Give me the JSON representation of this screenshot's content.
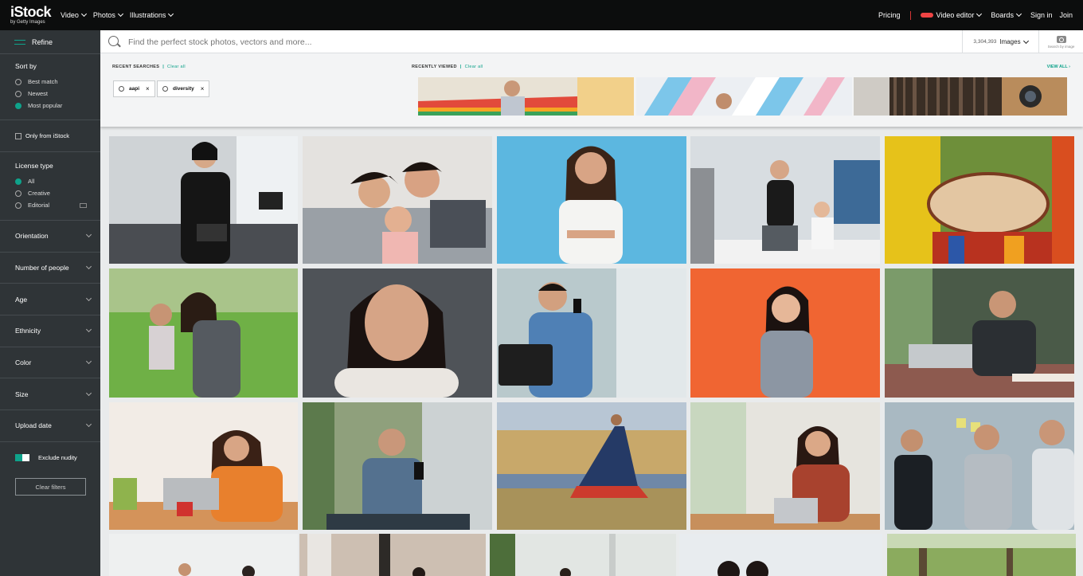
{
  "header": {
    "logo_text": "iStock",
    "logo_tagline": "by Getty Images",
    "nav": [
      {
        "label": "Video"
      },
      {
        "label": "Photos"
      },
      {
        "label": "Illustrations"
      }
    ],
    "right_nav": {
      "pricing": "Pricing",
      "video_editor": "Video editor",
      "boards": "Boards",
      "sign_in": "Sign in",
      "join": "Join"
    }
  },
  "sidebar": {
    "refine_label": "Refine",
    "sort_by": {
      "title": "Sort by",
      "options": [
        "Best match",
        "Newest",
        "Most popular"
      ],
      "selected": "Most popular"
    },
    "only_from_istock": "Only from iStock",
    "license_type": {
      "title": "License type",
      "options": [
        "All",
        "Creative",
        "Editorial"
      ],
      "selected": "All"
    },
    "filters": [
      "Orientation",
      "Number of people",
      "Age",
      "Ethnicity",
      "Color",
      "Size",
      "Upload date"
    ],
    "exclude_nudity": "Exclude nudity",
    "clear_filters": "Clear filters"
  },
  "search": {
    "placeholder": "Find the perfect stock photos, vectors and more...",
    "result_count": "3,304,393",
    "media_type": "Images",
    "search_by_image": "Search by image"
  },
  "recent": {
    "searches_title": "RECENT SEARCHES",
    "clear_all": "Clear all",
    "chips": [
      {
        "label": "aapi"
      },
      {
        "label": "diversity"
      }
    ],
    "viewed_title": "RECENTLY VIEWED",
    "view_all": "VIEW ALL ›"
  },
  "colors": {
    "accent": "#0fa38b",
    "topbar": "#0c0d0d",
    "sidebar": "#2f3437"
  },
  "icons": {
    "search": "search-icon",
    "camera": "camera-icon",
    "refine": "sliders-icon"
  }
}
